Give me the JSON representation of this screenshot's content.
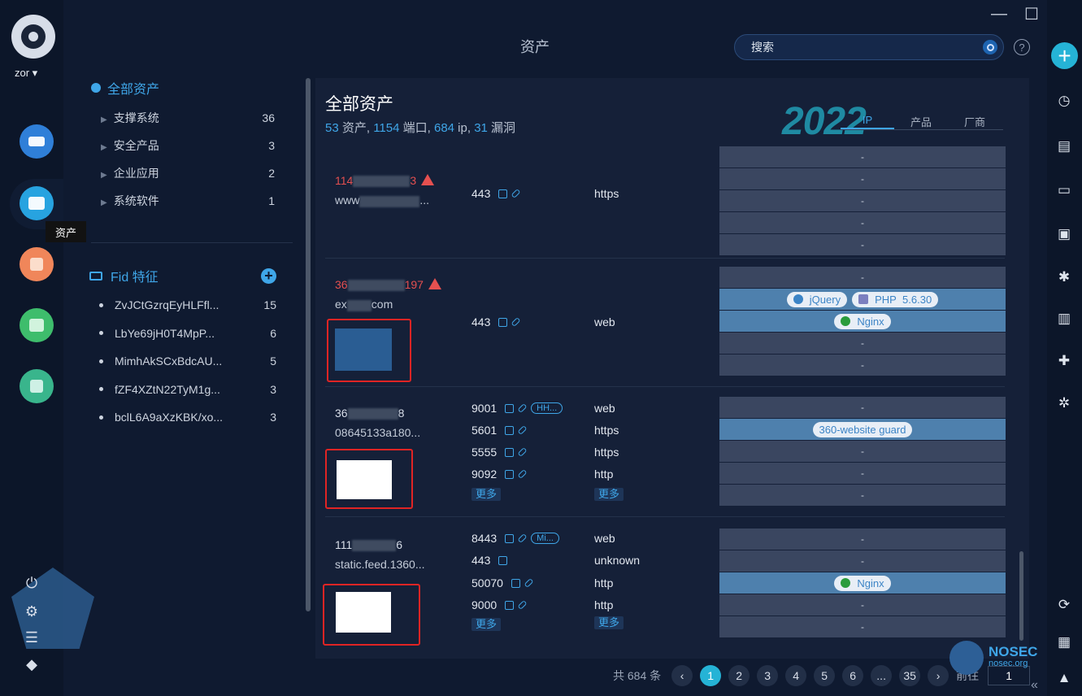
{
  "user": {
    "name": "zor"
  },
  "tooltip": "资产",
  "title": "资产",
  "search": {
    "placeholder": "搜索"
  },
  "help": "?",
  "window": {
    "minimize": "—",
    "maximize": "☐",
    "close": "✕"
  },
  "categories": {
    "header": "全部资产",
    "items": [
      {
        "label": "支撑系统",
        "count": "36"
      },
      {
        "label": "安全产品",
        "count": "3"
      },
      {
        "label": "企业应用",
        "count": "2"
      },
      {
        "label": "系统软件",
        "count": "1"
      }
    ]
  },
  "fid": {
    "header": "Fid 特征",
    "items": [
      {
        "label": "ZvJCtGzrqEyHLFfl...",
        "count": "15"
      },
      {
        "label": "LbYe69jH0T4MpP...",
        "count": "6"
      },
      {
        "label": "MimhAkSCxBdcAU...",
        "count": "5"
      },
      {
        "label": "fZF4XZtN22TyM1g...",
        "count": "3"
      },
      {
        "label": "bclL6A9aXzKBK/xo...",
        "count": "3"
      }
    ]
  },
  "main": {
    "title": "全部资产",
    "stats": {
      "assets": "53",
      "assets_label": " 资产, ",
      "ports": "1154",
      "ports_label": " 端口, ",
      "ips": "684",
      "ips_label": " ip, ",
      "vulns": "31",
      "vulns_label": " 漏洞"
    },
    "year": "2022",
    "tabs": [
      "IP",
      "产品",
      "厂商"
    ]
  },
  "rows": [
    {
      "ip_a": "114",
      "ip_b": "3",
      "domain_a": "www",
      "domain_b": "...",
      "ports": [
        {
          "port": "443",
          "proto": "https"
        }
      ],
      "fingerprints": [
        "-",
        "-",
        "-",
        "-",
        "-"
      ]
    },
    {
      "ip_a": "36",
      "ip_b": "197",
      "domain_a": "ex",
      "domain_b": "com",
      "ports": [
        {
          "port": "443",
          "proto": "web"
        }
      ],
      "fingerprints": [
        "-",
        "jquery_php",
        "nginx",
        "-",
        "-"
      ],
      "chips": {
        "jquery": "jQuery",
        "php": "PHP",
        "php_ver": "5.6.30",
        "nginx": "Nginx"
      }
    },
    {
      "ip_a": "36",
      "ip_b": "8",
      "domain": "08645133a180...",
      "ports": [
        {
          "port": "9001",
          "proto": "web",
          "tag": "HH..."
        },
        {
          "port": "5601",
          "proto": "https"
        },
        {
          "port": "5555",
          "proto": "https"
        },
        {
          "port": "9092",
          "proto": "http"
        }
      ],
      "more": "更多",
      "fingerprints": [
        "-",
        "360",
        "-",
        "-",
        "-"
      ],
      "chips": {
        "guard": "360-website guard"
      }
    },
    {
      "ip_a": "111",
      "ip_b": "6",
      "domain": "static.feed.1360...",
      "ports": [
        {
          "port": "8443",
          "proto": "web",
          "tag": "Mi..."
        },
        {
          "port": "443",
          "proto": "unknown"
        },
        {
          "port": "50070",
          "proto": "http"
        },
        {
          "port": "9000",
          "proto": "http"
        }
      ],
      "more": "更多",
      "fingerprints": [
        "-",
        "-",
        "nginx",
        "-",
        "-"
      ],
      "chips": {
        "nginx": "Nginx"
      }
    }
  ],
  "pager": {
    "total": "共 684 条",
    "pages": [
      "1",
      "2",
      "3",
      "4",
      "5",
      "6",
      "...",
      "35"
    ],
    "current": "1",
    "goto_label": "前往",
    "goto_value": "1"
  },
  "watermark": {
    "name": "NOSEC",
    "url": "nosec.org"
  }
}
